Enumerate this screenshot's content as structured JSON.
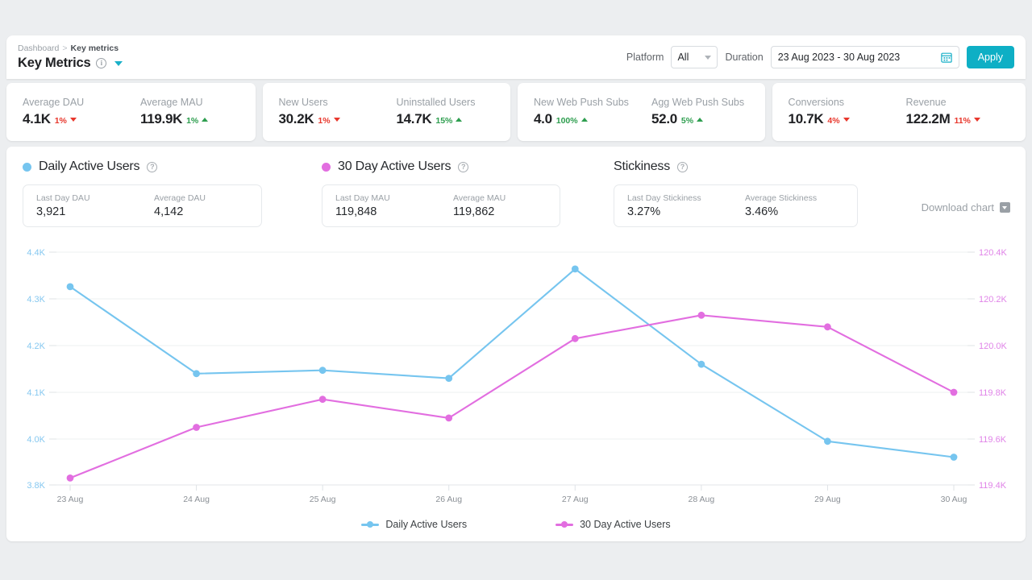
{
  "header": {
    "breadcrumb_root": "Dashboard",
    "breadcrumb_sep": ">",
    "breadcrumb_current": "Key metrics",
    "title": "Key Metrics",
    "info_icon": "info-circle-icon",
    "chevron_icon": "chevron-down-icon"
  },
  "controls": {
    "platform_label": "Platform",
    "platform_value": "All",
    "duration_label": "Duration",
    "duration_value": "23 Aug 2023 - 30 Aug 2023",
    "calendar_icon": "calendar-icon",
    "apply_label": "Apply"
  },
  "kpi_cards": [
    {
      "metrics": [
        {
          "label": "Average DAU",
          "value": "4.1K",
          "delta": "1%",
          "direction": "down"
        },
        {
          "label": "Average MAU",
          "value": "119.9K",
          "delta": "1%",
          "direction": "up"
        }
      ]
    },
    {
      "metrics": [
        {
          "label": "New Users",
          "value": "30.2K",
          "delta": "1%",
          "direction": "down"
        },
        {
          "label": "Uninstalled Users",
          "value": "14.7K",
          "delta": "15%",
          "direction": "up"
        }
      ]
    },
    {
      "metrics": [
        {
          "label": "New Web Push Subs",
          "value": "4.0",
          "delta": "100%",
          "direction": "up"
        },
        {
          "label": "Agg Web Push Subs",
          "value": "52.0",
          "delta": "5%",
          "direction": "up"
        }
      ]
    },
    {
      "metrics": [
        {
          "label": "Conversions",
          "value": "10.7K",
          "delta": "4%",
          "direction": "down"
        },
        {
          "label": "Revenue",
          "value": "122.2M",
          "delta": "11%",
          "direction": "down"
        }
      ]
    }
  ],
  "metric_groups": [
    {
      "title": "Daily Active Users",
      "dot_color": "#76c5ef",
      "has_dot": true,
      "help_icon": "help-circle-icon",
      "stats": [
        {
          "label": "Last Day DAU",
          "value": "3,921"
        },
        {
          "label": "Average DAU",
          "value": "4,142"
        }
      ]
    },
    {
      "title": "30 Day Active Users",
      "dot_color": "#e26ee0",
      "has_dot": true,
      "help_icon": "help-circle-icon",
      "stats": [
        {
          "label": "Last Day MAU",
          "value": "119,848"
        },
        {
          "label": "Average MAU",
          "value": "119,862"
        }
      ]
    },
    {
      "title": "Stickiness",
      "dot_color": "",
      "has_dot": false,
      "help_icon": "help-circle-icon",
      "stats": [
        {
          "label": "Last Day Stickiness",
          "value": "3.27%"
        },
        {
          "label": "Average Stickiness",
          "value": "3.46%"
        }
      ]
    }
  ],
  "download": {
    "label": "Download chart",
    "icon": "download-chart-icon"
  },
  "chart_data": {
    "type": "line",
    "title": "",
    "xlabel": "",
    "grid": true,
    "legend_position": "bottom",
    "categories": [
      "23 Aug",
      "24 Aug",
      "25 Aug",
      "26 Aug",
      "27 Aug",
      "28 Aug",
      "29 Aug",
      "30 Aug"
    ],
    "series": [
      {
        "name": "Daily Active Users",
        "color": "#76c5ef",
        "axis": "left",
        "values": [
          4326,
          4140,
          4147,
          4130,
          4364,
          4160,
          3990,
          3921
        ]
      },
      {
        "name": "30 Day Active Users",
        "color": "#e26ee0",
        "axis": "right",
        "values": [
          119430,
          119650,
          119770,
          119690,
          120030,
          120130,
          120080,
          119800
        ]
      }
    ],
    "left_axis": {
      "label": "",
      "color": "#86c8f0",
      "ticks": [
        {
          "label": "4.4K",
          "value": 4400
        },
        {
          "label": "4.3K",
          "value": 4300
        },
        {
          "label": "4.2K",
          "value": 4200
        },
        {
          "label": "4.1K",
          "value": 4100
        },
        {
          "label": "4.0K",
          "value": 4000
        },
        {
          "label": "3.8K",
          "value": 3800
        }
      ]
    },
    "right_axis": {
      "label": "",
      "color": "#e084e8",
      "ticks": [
        {
          "label": "120.4K",
          "value": 120400
        },
        {
          "label": "120.2K",
          "value": 120200
        },
        {
          "label": "120.0K",
          "value": 120000
        },
        {
          "label": "119.8K",
          "value": 119800
        },
        {
          "label": "119.6K",
          "value": 119600
        },
        {
          "label": "119.4K",
          "value": 119400
        }
      ]
    }
  }
}
